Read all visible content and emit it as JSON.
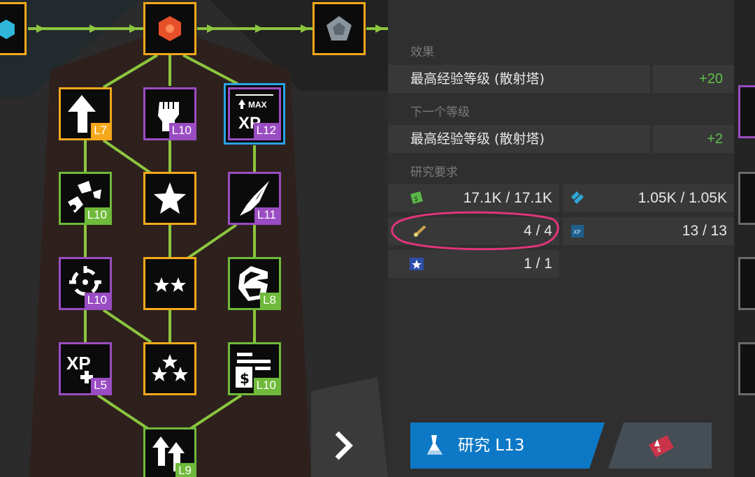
{
  "tree": {
    "nodes": [
      {
        "id": "top-left-gem",
        "border": "yellow",
        "icon": "hexagon-gem-icon",
        "level": ""
      },
      {
        "id": "top-center",
        "border": "yellow",
        "icon": "orange-gear-hex-icon",
        "level": ""
      },
      {
        "id": "top-right",
        "border": "yellow",
        "icon": "pentagon-gem-icon",
        "level": ""
      },
      {
        "id": "range-up",
        "border": "yellow",
        "icon": "arrow-up-icon",
        "level": "L7"
      },
      {
        "id": "power-fist",
        "border": "purple",
        "icon": "fist-icon",
        "level": "L10"
      },
      {
        "id": "max-xp",
        "border": "purple",
        "icon": "max-xp-icon",
        "level": "L12",
        "selected": true
      },
      {
        "id": "shatter",
        "border": "green",
        "icon": "shatter-icon",
        "level": "L10"
      },
      {
        "id": "star-1",
        "border": "yellow",
        "icon": "star-icon",
        "level": ""
      },
      {
        "id": "pierce",
        "border": "purple",
        "icon": "pierce-icon",
        "level": "L11"
      },
      {
        "id": "crosshair",
        "border": "purple",
        "icon": "crosshair-icon",
        "level": "L10"
      },
      {
        "id": "star-2",
        "border": "yellow",
        "icon": "two-stars-icon",
        "level": ""
      },
      {
        "id": "chomper",
        "border": "green",
        "icon": "chomper-icon",
        "level": "L8"
      },
      {
        "id": "xp-plus",
        "border": "purple",
        "icon": "xp-plus-icon",
        "level": "L5"
      },
      {
        "id": "star-3",
        "border": "yellow",
        "icon": "three-stars-icon",
        "level": ""
      },
      {
        "id": "bounty",
        "border": "green",
        "icon": "bounty-list-icon",
        "level": "L10"
      },
      {
        "id": "bottom",
        "border": "green",
        "icon": "bottom-arrows-icon",
        "level": "L9"
      }
    ],
    "next_arrow": "chevron-right-icon"
  },
  "panel": {
    "effect_header": "效果",
    "effect_label": "最高经验等级 (散射塔)",
    "effect_value": "+20",
    "next_header": "下一个等级",
    "next_label": "最高经验等级 (散射塔)",
    "next_value": "+2",
    "req_header": "研究要求",
    "requirements": [
      {
        "icon": "green-cash-icon",
        "amount": "17.1K / 17.1K"
      },
      {
        "icon": "blue-bits-icon",
        "amount": "1.05K / 1.05K"
      },
      {
        "icon": "brush-token-icon",
        "amount": "4 / 4"
      },
      {
        "icon": "xp-scroll-icon",
        "amount": "13 / 13"
      },
      {
        "icon": "star-scroll-icon",
        "amount": "1 / 1"
      }
    ],
    "research_button": "研究 L13",
    "ticket_icon": "research-ticket-icon"
  },
  "colors": {
    "yellow": "#f5a81c",
    "purple": "#9a4cc2",
    "green": "#6fba3a",
    "connector": "#8cc63f",
    "highlight": "#e0357a",
    "button": "#0d79c6"
  }
}
